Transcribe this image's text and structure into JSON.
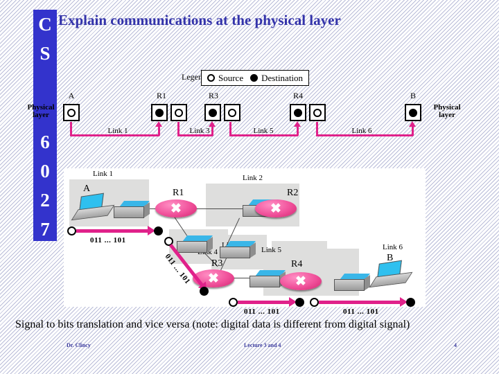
{
  "slide": {
    "title": "Explain communications at the physical layer",
    "caption": "Signal to bits translation and vice versa (note: digital data is different from digital signal)",
    "brand_chars": [
      "C",
      "S",
      "6",
      "0",
      "2",
      "7"
    ],
    "brand_color": "#3333cc",
    "title_color": "#3333aa",
    "accent_color": "#e0218a"
  },
  "legend": {
    "label": "Legend",
    "source_label": "Source",
    "destination_label": "Destination"
  },
  "physical_layer": {
    "left_caption": "Physical layer",
    "right_caption": "Physical layer"
  },
  "top_diagram": {
    "nodes": [
      {
        "label": "A",
        "type": "single",
        "marker": "source"
      },
      {
        "label": "R1",
        "type": "pair",
        "left_marker": "destination",
        "right_marker": "source"
      },
      {
        "label": "R3",
        "type": "pair",
        "left_marker": "destination",
        "right_marker": "source"
      },
      {
        "label": "R4",
        "type": "pair",
        "left_marker": "destination",
        "right_marker": "source"
      },
      {
        "label": "B",
        "type": "single",
        "marker": "destination"
      }
    ],
    "links": [
      "Link 1",
      "Link 3",
      "Link 5",
      "Link 6"
    ]
  },
  "bottom_diagram": {
    "lan_labels": [
      "Link 1",
      "Link 2",
      "Link 3",
      "Link 4",
      "Link 5",
      "Link 6"
    ],
    "hosts": [
      "A",
      "B"
    ],
    "routers": [
      "R1",
      "R2",
      "R3",
      "R4"
    ],
    "bit_streams": [
      "011 ... 101",
      "011 ... 101",
      "011 ... 101",
      "011 ... 101"
    ]
  },
  "footer": {
    "author": "Dr. Clincy",
    "lecture": "Lecture 3 and 4",
    "page": "4"
  }
}
